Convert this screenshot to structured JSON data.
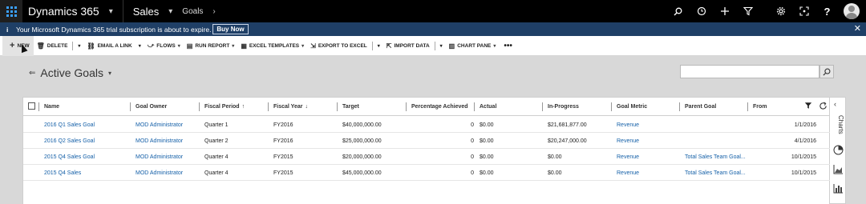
{
  "topbar": {
    "app_name": "Dynamics 365",
    "area": "Sales",
    "breadcrumb": "Goals",
    "icons": [
      "search-icon",
      "history-icon",
      "plus-icon",
      "filter-icon",
      "settings-icon",
      "assistant-icon",
      "help-icon",
      "user-avatar"
    ]
  },
  "banner": {
    "text": "Your Microsoft Dynamics 365 trial subscription is about to expire.",
    "button": "Buy Now"
  },
  "commands": {
    "new": "NEW",
    "delete": "DELETE",
    "email_link": "EMAIL A LINK",
    "flows": "FLOWS",
    "run_report": "RUN REPORT",
    "excel_templates": "EXCEL TEMPLATES",
    "export_excel": "EXPORT TO EXCEL",
    "import_data": "IMPORT DATA",
    "chart_pane": "CHART PANE",
    "more": "•••"
  },
  "view": {
    "title": "Active Goals",
    "search_placeholder": ""
  },
  "grid": {
    "columns": {
      "name": "Name",
      "goal_owner": "Goal Owner",
      "fiscal_period": "Fiscal Period",
      "fiscal_year": "Fiscal Year",
      "target": "Target",
      "percentage_achieved": "Percentage Achieved",
      "actual": "Actual",
      "in_progress": "In-Progress",
      "goal_metric": "Goal Metric",
      "parent_goal": "Parent Goal",
      "from": "From"
    },
    "sort_asc": "↑",
    "sort_desc": "↓",
    "rows": [
      {
        "name": "2016 Q1 Sales Goal",
        "owner": "MOD Administrator",
        "period": "Quarter 1",
        "year": "FY2016",
        "target": "$40,000,000.00",
        "pct": "0",
        "actual": "$0.00",
        "in_progress": "$21,681,877.00",
        "metric": "Revenue",
        "parent": "",
        "from": "1/1/2016"
      },
      {
        "name": "2016 Q2 Sales Goal",
        "owner": "MOD Administrator",
        "period": "Quarter 2",
        "year": "FY2016",
        "target": "$25,000,000.00",
        "pct": "0",
        "actual": "$0.00",
        "in_progress": "$20,247,000.00",
        "metric": "Revenue",
        "parent": "",
        "from": "4/1/2016"
      },
      {
        "name": "2015 Q4 Sales Goal",
        "owner": "MOD Administrator",
        "period": "Quarter 4",
        "year": "FY2015",
        "target": "$20,000,000.00",
        "pct": "0",
        "actual": "$0.00",
        "in_progress": "$0.00",
        "metric": "Revenue",
        "parent": "Total Sales Team Goal...",
        "from": "10/1/2015"
      },
      {
        "name": "2015 Q4 Sales",
        "owner": "MOD Administrator",
        "period": "Quarter 4",
        "year": "FY2015",
        "target": "$45,000,000.00",
        "pct": "0",
        "actual": "$0.00",
        "in_progress": "$0.00",
        "metric": "Revenue",
        "parent": "Total Sales Team Goal...",
        "from": "10/1/2015"
      }
    ]
  },
  "rail": {
    "label": "Charts"
  }
}
